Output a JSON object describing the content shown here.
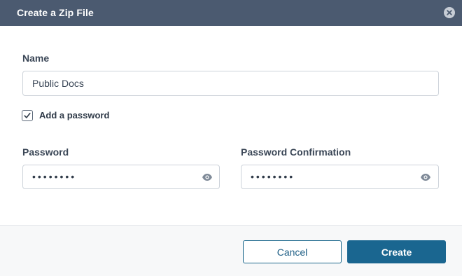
{
  "dialog": {
    "title": "Create a Zip File",
    "close_icon": "close-icon"
  },
  "form": {
    "name_label": "Name",
    "name_value": "Public Docs",
    "add_password_label": "Add a password",
    "add_password_checked": true,
    "password_label": "Password",
    "password_mask": "••••••••",
    "password_confirmation_label": "Password Confirmation",
    "password_confirmation_mask": "••••••••",
    "show_password_icon": "eye-icon"
  },
  "footer": {
    "cancel_label": "Cancel",
    "create_label": "Create"
  },
  "colors": {
    "titlebar": "#4b5a70",
    "primary": "#1a6690"
  }
}
